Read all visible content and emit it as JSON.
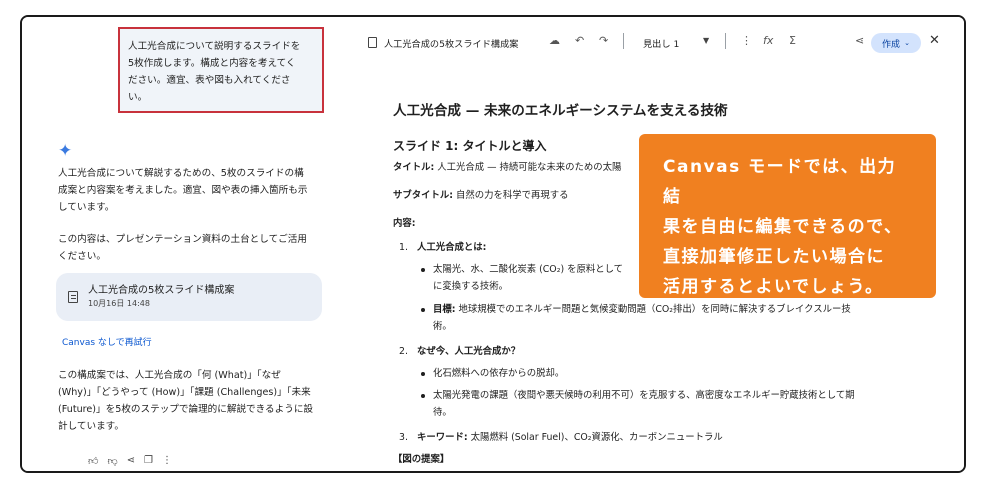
{
  "prompt": {
    "line1": "人工光合成について説明するスライドを",
    "line2": "5枚作成します。構成と内容を考えてく",
    "line3": "ださい。適宜、表や図も入れてくださ",
    "line4": "い。"
  },
  "chat": {
    "response1_line1": "人工光合成について解説するための、5枚のスライドの構",
    "response1_line2": "成案と内容案を考えました。適宜、図や表の挿入箇所も示",
    "response1_line3": "しています。",
    "response2_line1": "この内容は、プレゼンテーション資料の土台としてご活用",
    "response2_line2": "ください。",
    "doc_card_title": "人工光合成の5枚スライド構成案",
    "doc_card_date": "10月16日 14:48",
    "retry_link": "Canvas なしで再試行",
    "response3_line1": "この構成案では、人工光合成の「何 (What)」「なぜ",
    "response3_line2": "(Why)」「どうやって (How)」「課題 (Challenges)」「未来",
    "response3_line3": "(Future)」を5枚のステップで論理的に解説できるように設",
    "response3_line4": "計しています。"
  },
  "toolbar": {
    "doc_title": "人工光合成の5枚スライド構成案",
    "heading_style": "見出し 1",
    "create_label": "作成"
  },
  "document": {
    "h1": "人工光合成 — 未来のエネルギーシステムを支える技術",
    "h2": "スライド 1: タイトルと導入",
    "title_label": "タイトル:",
    "title_value": " 人工光合成 — 持続可能な未来のための太陽",
    "subtitle_label": "サブタイトル:",
    "subtitle_value": " 自然の力を科学で再現する",
    "content_label": "内容:",
    "item1_num": "1.",
    "item1_title": "人工光合成とは:",
    "item1_b1_line1": "太陽光、水、二酸化炭素 (CO₂) を原料として",
    "item1_b1_line2": "に変換する技術。",
    "item1_b2_label": "目標:",
    "item1_b2_line1": " 地球規模でのエネルギー問題と気候変動問題（CO₂排出）を同時に解決するブレイクスルー技",
    "item1_b2_line2": "術。",
    "item2_num": "2.",
    "item2_title": "なぜ今、人工光合成か？",
    "item2_b1": "化石燃料への依存からの脱却。",
    "item2_b2_line1": "太陽光発電の課題（夜間や悪天候時の利用不可）を克服する、高密度なエネルギー貯蔵技術として期",
    "item2_b2_line2": "待。",
    "item3_num": "3.",
    "item3_label": "キーワード:",
    "item3_value": " 太陽燃料 (Solar Fuel)、CO₂資源化、カーボンニュートラル",
    "figure_label": "【図の提案】"
  },
  "callout": {
    "line1": "Canvas モードでは、出力結",
    "line2": "果を自由に編集できるので、",
    "line3": "直接加筆修正したい場合に",
    "line4": "活用するとよいでしょう。"
  },
  "colors": {
    "callout_bg": "#f08020",
    "prompt_border": "#c8323c",
    "create_button_bg": "#d3e3fd",
    "link": "#0b57d0"
  }
}
